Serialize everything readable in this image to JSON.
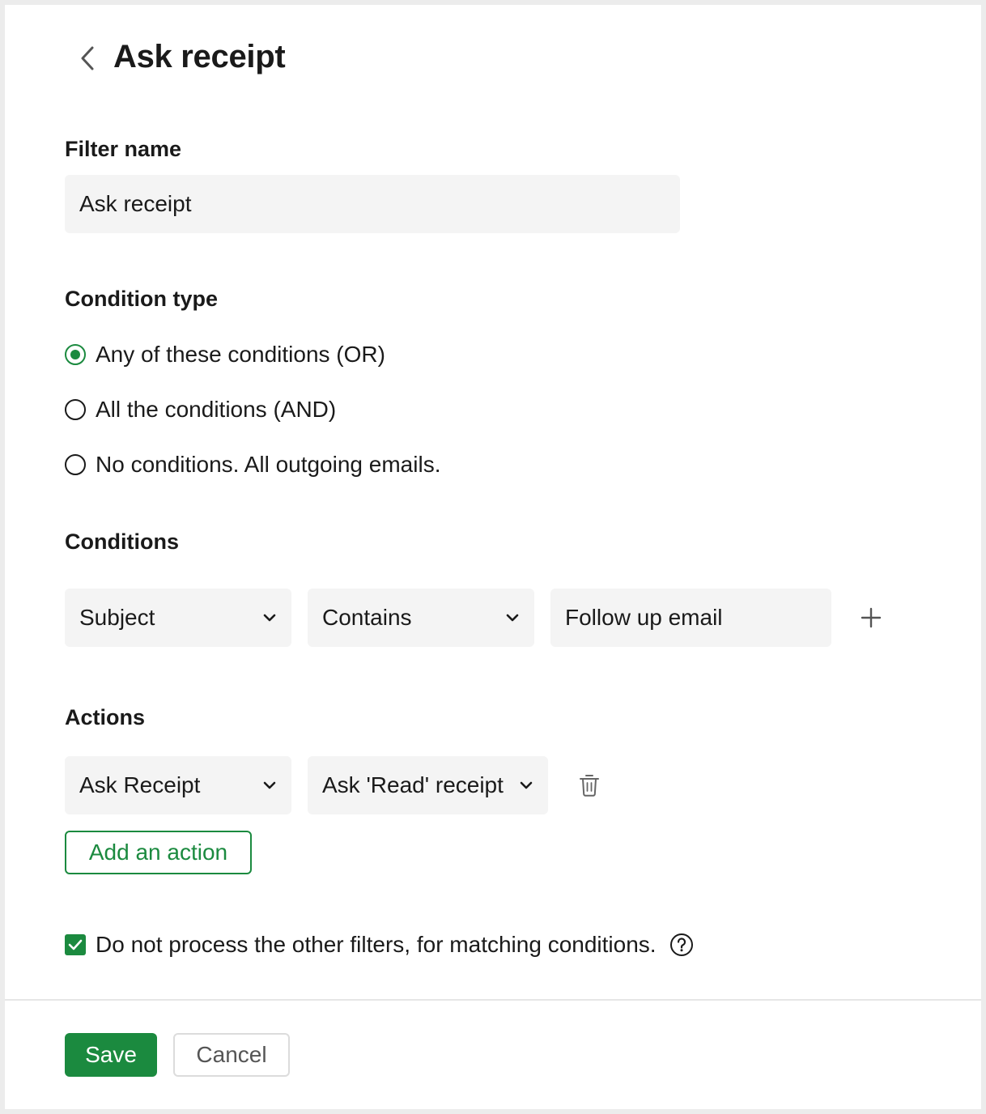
{
  "header": {
    "title": "Ask receipt"
  },
  "filter_name": {
    "label": "Filter name",
    "value": "Ask receipt"
  },
  "condition_type": {
    "label": "Condition type",
    "options": [
      {
        "label": "Any of these conditions (OR)",
        "checked": true
      },
      {
        "label": "All the conditions (AND)",
        "checked": false
      },
      {
        "label": "No conditions. All outgoing emails.",
        "checked": false
      }
    ]
  },
  "conditions": {
    "label": "Conditions",
    "field": "Subject",
    "operator": "Contains",
    "value": "Follow up email"
  },
  "actions": {
    "label": "Actions",
    "action": "Ask Receipt",
    "option": "Ask 'Read' receipt",
    "add_label": "Add an action"
  },
  "stop_processing": {
    "label": "Do not process the other filters, for matching conditions.",
    "checked": true
  },
  "footer": {
    "save_label": "Save",
    "cancel_label": "Cancel"
  },
  "colors": {
    "accent": "#1b8a3f",
    "field_bg": "#f4f4f4"
  },
  "icons": [
    "chevron-left-icon",
    "chevron-down-icon",
    "plus-icon",
    "trash-icon",
    "checkmark-icon",
    "help-icon"
  ]
}
